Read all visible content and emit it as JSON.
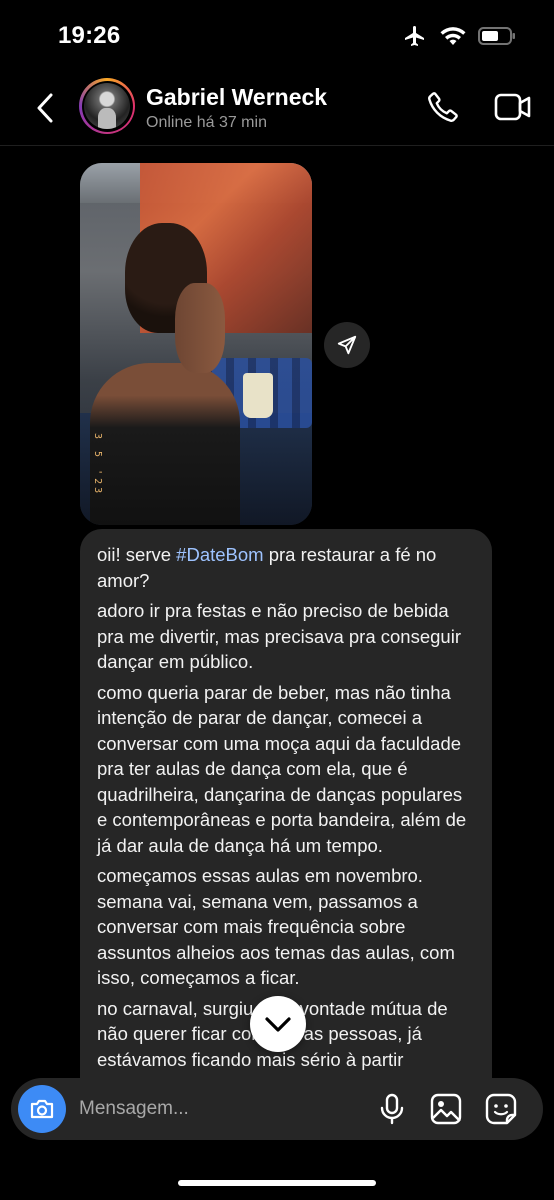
{
  "status_bar": {
    "time": "19:26",
    "icons": [
      "airplane-icon",
      "wifi-icon",
      "battery-icon"
    ]
  },
  "header": {
    "contact_name": "Gabriel Werneck",
    "contact_status": "Online há 37 min",
    "icons": [
      "back-chevron-icon",
      "phone-icon",
      "video-camera-icon"
    ]
  },
  "messages": {
    "photo": {
      "date_stamp": "3 5 '23"
    },
    "text": {
      "paragraph_1_before": "oii! serve ",
      "hashtag": "#DateBom",
      "paragraph_1_after": " pra restaurar a fé no amor?",
      "paragraph_2": "adoro ir pra festas e não preciso de bebida pra me divertir, mas precisava pra conseguir dançar em público.",
      "paragraph_3": "como queria parar de beber, mas não tinha intenção de parar de dançar, comecei a conversar com uma moça aqui da faculdade pra ter aulas de dança com ela, que é quadrilheira, dançarina de danças populares e contemporâneas e porta bandeira, além de já dar aula de dança há um tempo.",
      "paragraph_4": "começamos essas aulas em novembro. semana vai, semana vem, passamos a conversar com mais frequência sobre assuntos alheios aos temas das aulas, com isso, começamos a ficar.",
      "paragraph_5": "no carnaval, surgiu uma vontade mútua de não querer ficar com outras pessoas, já estávamos ficando mais sério à partir"
    }
  },
  "composer": {
    "placeholder": "Mensagem...",
    "icons": [
      "camera-icon",
      "microphone-icon",
      "image-gallery-icon",
      "sticker-icon"
    ]
  },
  "colors": {
    "background": "#000000",
    "bubble": "#262626",
    "accent_blue": "#3d8bf5",
    "hashtag": "#9ec3ff",
    "secondary_text": "#9a9a9a"
  }
}
